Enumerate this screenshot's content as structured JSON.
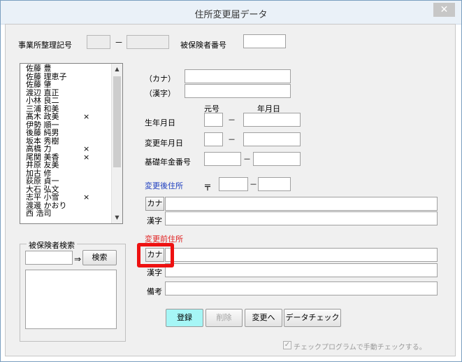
{
  "window": {
    "title": "住所変更届データ",
    "close_symbol": "✕"
  },
  "header": {
    "office_code_label": "事業所整理記号",
    "dash": "－",
    "insured_no_label": "被保険者番号"
  },
  "list": {
    "items": [
      {
        "name": "佐藤 豊",
        "mark": ""
      },
      {
        "name": "佐藤 理恵子",
        "mark": ""
      },
      {
        "name": "佐藤 肇",
        "mark": ""
      },
      {
        "name": "渡辺 直正",
        "mark": ""
      },
      {
        "name": "小林 良二",
        "mark": ""
      },
      {
        "name": "三浦 和美",
        "mark": ""
      },
      {
        "name": "髙木 政美",
        "mark": "×"
      },
      {
        "name": "伊勢 順一",
        "mark": ""
      },
      {
        "name": "後藤 純男",
        "mark": ""
      },
      {
        "name": "坂本 秀樹",
        "mark": ""
      },
      {
        "name": "高橋 力",
        "mark": "×"
      },
      {
        "name": "尾関 美香",
        "mark": "×"
      },
      {
        "name": "井原 友美",
        "mark": ""
      },
      {
        "name": "加古 修",
        "mark": ""
      },
      {
        "name": "荻原 貞一",
        "mark": ""
      },
      {
        "name": "大石 弘文",
        "mark": ""
      },
      {
        "name": "志平 小雪",
        "mark": "×"
      },
      {
        "name": "渡邊 かおり",
        "mark": ""
      },
      {
        "name": "西 浩司",
        "mark": ""
      }
    ]
  },
  "search": {
    "group_label": "被保険者検索",
    "arrow": "⇒",
    "button": "検索"
  },
  "person": {
    "kana_label": "（カナ）",
    "kanji_label": "（漢字）",
    "era_header": "元号",
    "ymd_header": "年月日",
    "birth_label": "生年月日",
    "change_date_label": "変更年月日",
    "pension_label": "基礎年金番号",
    "dash": "－"
  },
  "new_address": {
    "label": "変更後住所",
    "postal_mark": "〒",
    "dash": "－",
    "kana_btn": "カナ",
    "kanji_label": "漢字"
  },
  "old_address": {
    "label": "変更前住所",
    "kana_btn": "カナ",
    "kanji_label": "漢字",
    "remarks_label": "備考"
  },
  "buttons": {
    "register": "登録",
    "delete": "削除",
    "to_change": "変更へ",
    "data_check": "データチェック"
  },
  "footer": {
    "check_symbol": "✓",
    "check_label": "チェックプログラムで手動チェックする。"
  },
  "colors": {
    "register_bg": "#a6f6f6",
    "section_blue": "#1f3fbf",
    "section_red": "#e02020",
    "highlight": "#e11111"
  }
}
